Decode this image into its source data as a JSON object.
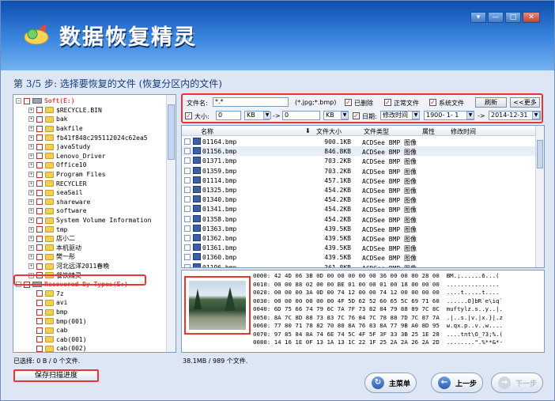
{
  "app": {
    "title": "数据恢复精灵"
  },
  "window_controls": [
    "▾",
    "—",
    "□",
    "✕"
  ],
  "step_text": "第 3/5 步: 选择要恢复的文件 (恢复分区内的文件)",
  "tree": [
    {
      "label": "Soft(E:)",
      "type": "drive",
      "indent": 0,
      "pm": "−"
    },
    {
      "label": "$RECYCLE.BIN",
      "indent": 1,
      "pm": "+"
    },
    {
      "label": "bak",
      "indent": 1,
      "pm": "+"
    },
    {
      "label": "bakfile",
      "indent": 1,
      "pm": "+"
    },
    {
      "label": "fb41f848c295112024c62ea5",
      "indent": 1,
      "pm": "+"
    },
    {
      "label": "javaStudy",
      "indent": 1,
      "pm": "+"
    },
    {
      "label": "Lenovo_Driver",
      "indent": 1,
      "pm": "+"
    },
    {
      "label": "Office10",
      "indent": 1,
      "pm": "+"
    },
    {
      "label": "Program Files",
      "indent": 1,
      "pm": "+"
    },
    {
      "label": "RECYCLER",
      "indent": 1,
      "pm": "+"
    },
    {
      "label": "seaSail",
      "indent": 1,
      "pm": "+"
    },
    {
      "label": "shareware",
      "indent": 1,
      "pm": "+"
    },
    {
      "label": "software",
      "indent": 1,
      "pm": "+"
    },
    {
      "label": "System Volume Information",
      "indent": 1,
      "pm": "+"
    },
    {
      "label": "tmp",
      "indent": 1,
      "pm": "+"
    },
    {
      "label": "店小二",
      "indent": 1,
      "pm": "+"
    },
    {
      "label": "本机驱动",
      "indent": 1,
      "pm": "+"
    },
    {
      "label": "樊一彤",
      "indent": 1,
      "pm": "+"
    },
    {
      "label": "河北远洋2011春晚",
      "indent": 1,
      "pm": "+"
    },
    {
      "label": "餐饮精灵",
      "indent": 1,
      "pm": "+"
    },
    {
      "label": "Recovered By Types(E:)",
      "type": "drive",
      "indent": 0,
      "pm": "−"
    },
    {
      "label": "7z",
      "indent": 1,
      "pm": ""
    },
    {
      "label": "avi",
      "indent": 1,
      "pm": ""
    },
    {
      "label": "bmp",
      "indent": 1,
      "pm": ""
    },
    {
      "label": "bmp(001)",
      "indent": 1,
      "pm": ""
    },
    {
      "label": "cab",
      "indent": 1,
      "pm": ""
    },
    {
      "label": "cab(001)",
      "indent": 1,
      "pm": ""
    },
    {
      "label": "cab(002)",
      "indent": 1,
      "pm": ""
    }
  ],
  "filter": {
    "filename_label": "文件名:",
    "filename_value": "*.*",
    "filename_hint": "(*.jpg;*.bmp)",
    "deleted_label": "已删除",
    "normal_label": "正常文件",
    "system_label": "系统文件",
    "refresh_label": "刷新",
    "more_label": "<<更多",
    "size_label": "大小:",
    "size_min": "0",
    "size_unit_min": "KB",
    "arrow": "->",
    "size_max": "0",
    "size_unit_max": "KB",
    "date_label": "日期:",
    "date_type": "修改时间",
    "date_from": "1900- 1- 1",
    "date_to": "2014-12-31"
  },
  "file_list": {
    "columns": [
      "名称",
      "文件大小",
      "文件类型",
      "属性",
      "修改时间"
    ],
    "rows": [
      {
        "name": "01164.bmp",
        "size": "900.1KB",
        "type": "ACDSee BMP 图像"
      },
      {
        "name": "01156.bmp",
        "size": "846.8KB",
        "type": "ACDSee BMP 图像"
      },
      {
        "name": "01371.bmp",
        "size": "703.2KB",
        "type": "ACDSee BMP 图像"
      },
      {
        "name": "01359.bmp",
        "size": "703.2KB",
        "type": "ACDSee BMP 图像"
      },
      {
        "name": "01114.bmp",
        "size": "457.1KB",
        "type": "ACDSee BMP 图像"
      },
      {
        "name": "01325.bmp",
        "size": "454.2KB",
        "type": "ACDSee BMP 图像"
      },
      {
        "name": "01340.bmp",
        "size": "454.2KB",
        "type": "ACDSee BMP 图像"
      },
      {
        "name": "01341.bmp",
        "size": "454.2KB",
        "type": "ACDSee BMP 图像"
      },
      {
        "name": "01358.bmp",
        "size": "454.2KB",
        "type": "ACDSee BMP 图像"
      },
      {
        "name": "01363.bmp",
        "size": "439.5KB",
        "type": "ACDSee BMP 图像"
      },
      {
        "name": "01362.bmp",
        "size": "439.5KB",
        "type": "ACDSee BMP 图像"
      },
      {
        "name": "01361.bmp",
        "size": "439.5KB",
        "type": "ACDSee BMP 图像"
      },
      {
        "name": "01360.bmp",
        "size": "439.5KB",
        "type": "ACDSee BMP 图像"
      },
      {
        "name": "01196.bmp",
        "size": "361.8KB",
        "type": "ACDSee BMP 图像"
      }
    ]
  },
  "hex_lines": [
    "0000: 42 4D 06 3B 0D 00 00 00 00 00 36 00 00 00 28 00  BM.;......6...(",
    "0010: 00 00 88 02 00 00 BE 01 00 00 01 00 18 00 00 00  ...............",
    "0020: 00 00 00 3A 0D 00 74 12 00 00 74 12 00 00 00 00  ....t.....t....",
    "0030: 00 00 00 00 00 00 4F 5D 62 52 60 65 5C 69 71 60  ......O]bR`e\\iq`",
    "0040: 6D 75 66 74 79 6C 7A 7F 73 82 84 79 88 89 7C 8C  muftylz.s..y..|.",
    "0050: 8A 7C 8D 88 73 83 7C 76 84 7C 78 88 7D 7C 87 7A  .|..s.|v.|x.}|.z",
    "0060: 77 80 71 78 82 70 80 8A 76 83 8A 77 9B A0 8D 95  w.qx.p..v..w....",
    "0070: 97 85 84 8A 74 6E 74 5C 4F 5F 3F 33 3B 25 1E 28  ....tnt\\O_?3;%.(",
    "0080: 14 16 1E 0F 13 1A 13 1C 22 1F 25 2A 2A 26 2A 2D  ........\".%**&*-"
  ],
  "status_left": "已选择: 0 B / 0 个文件.",
  "status_right": "38.1MB / 989 个文件.",
  "buttons": {
    "save_progress": "保存扫描进度",
    "main_menu": "主菜单",
    "prev": "上一步",
    "next": "下一步"
  }
}
